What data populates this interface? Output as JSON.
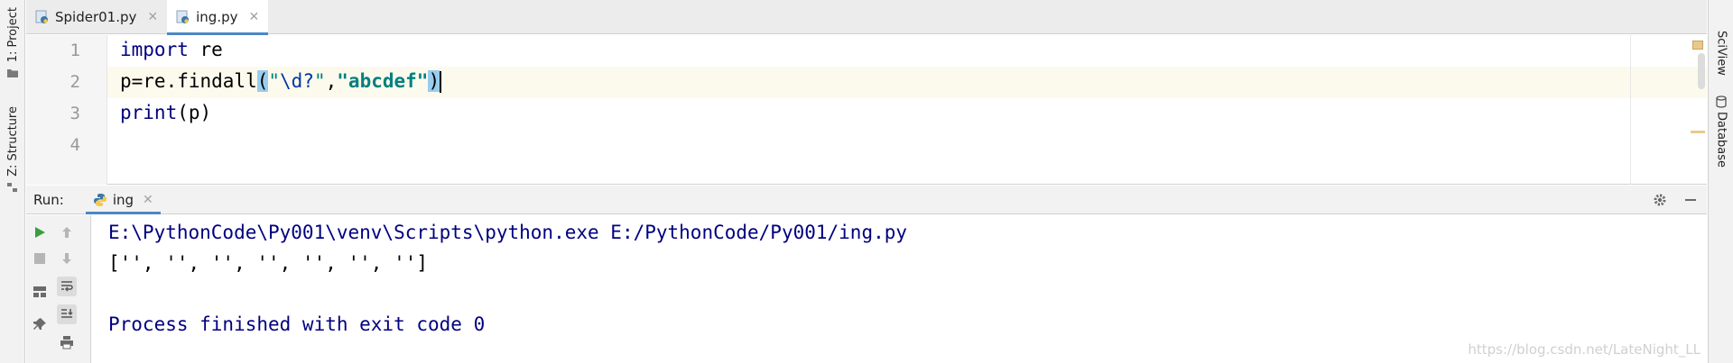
{
  "left_strip": {
    "project_tab": "1: Project",
    "structure_tab": "Z: Structure"
  },
  "right_strip": {
    "sciview_tab": "SciView",
    "database_tab": "Database"
  },
  "editor_tabs": [
    {
      "label": "Spider01.py",
      "active": false
    },
    {
      "label": "ing.py",
      "active": true
    }
  ],
  "editor": {
    "line_numbers": [
      "1",
      "2",
      "3",
      "4"
    ],
    "line1": {
      "kw": "import",
      "rest": " re"
    },
    "line2": {
      "prefix": "p=re.findall",
      "open": "(",
      "esc": "\\d?",
      "q1": "\"",
      "q2": "\"",
      "comma": ",",
      "str2": "\"abcdef\"",
      "close": ")"
    },
    "line3": {
      "kw": "print",
      "rest": "(p)"
    }
  },
  "run_panel": {
    "title": "Run:",
    "tab_label": "ing",
    "output": [
      "E:\\PythonCode\\Py001\\venv\\Scripts\\python.exe E:/PythonCode/Py001/ing.py",
      "['', '', '', '', '', '', '']",
      "",
      "Process finished with exit code 0"
    ]
  },
  "watermark": "https://blog.csdn.net/LateNight_LL",
  "colors": {
    "accent": "#4a88c7",
    "keyword": "#000080",
    "string": "#008080",
    "run_green": "#3c9d3c"
  }
}
